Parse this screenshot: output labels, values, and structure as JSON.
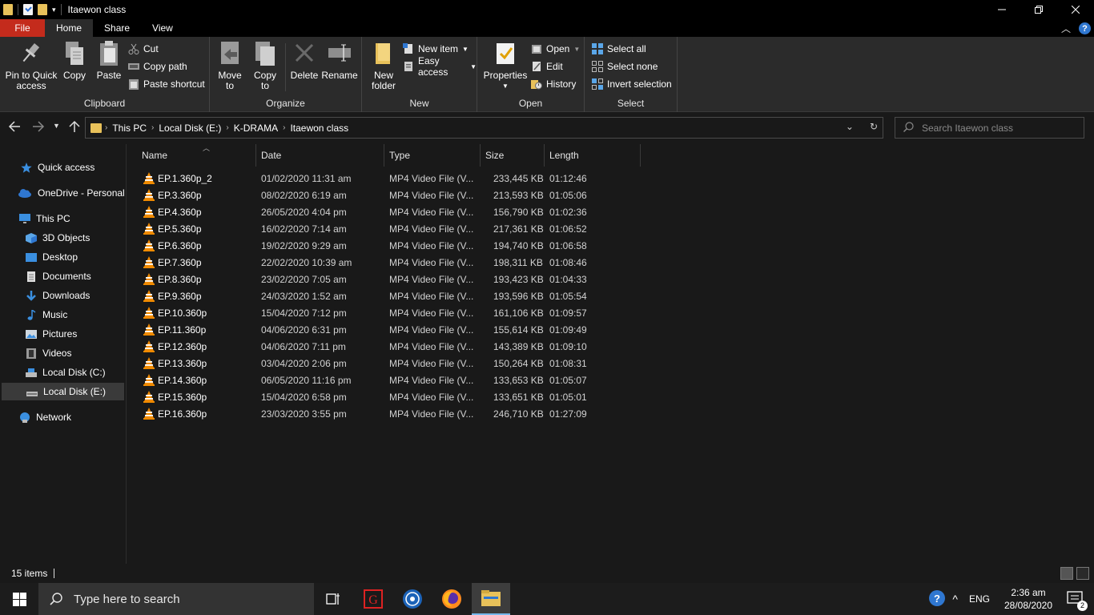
{
  "window": {
    "title": "Itaewon class"
  },
  "ribbon_tabs": [
    "File",
    "Home",
    "Share",
    "View"
  ],
  "ribbon": {
    "clipboard": {
      "label": "Clipboard",
      "pin": "Pin to Quick access",
      "pin_l1": "Pin to Quick",
      "pin_l2": "access",
      "copy": "Copy",
      "paste": "Paste",
      "cut": "Cut",
      "copy_path": "Copy path",
      "paste_shortcut": "Paste shortcut"
    },
    "organize": {
      "label": "Organize",
      "move_l1": "Move",
      "move_l2": "to",
      "copy_l1": "Copy",
      "copy_l2": "to",
      "delete": "Delete",
      "rename": "Rename"
    },
    "new": {
      "label": "New",
      "folder_l1": "New",
      "folder_l2": "folder",
      "new_item": "New item",
      "easy_access": "Easy access"
    },
    "open": {
      "label": "Open",
      "properties": "Properties",
      "open": "Open",
      "edit": "Edit",
      "history": "History"
    },
    "select": {
      "label": "Select",
      "select_all": "Select all",
      "select_none": "Select none",
      "invert": "Invert selection"
    }
  },
  "address": {
    "crumbs": [
      "This PC",
      "Local Disk (E:)",
      "K-DRAMA",
      "Itaewon class"
    ]
  },
  "search": {
    "placeholder": "Search Itaewon class"
  },
  "nav": {
    "quick_access": "Quick access",
    "onedrive": "OneDrive - Personal",
    "this_pc": "This PC",
    "objects3d": "3D Objects",
    "desktop": "Desktop",
    "documents": "Documents",
    "downloads": "Downloads",
    "music": "Music",
    "pictures": "Pictures",
    "videos": "Videos",
    "disk_c": "Local Disk (C:)",
    "disk_e": "Local Disk (E:)",
    "network": "Network"
  },
  "columns": {
    "name": "Name",
    "date": "Date",
    "type": "Type",
    "size": "Size",
    "length": "Length"
  },
  "files": [
    {
      "name": "EP.1.360p_2",
      "date": "01/02/2020 11:31 am",
      "type": "MP4 Video File (V...",
      "size": "233,445 KB",
      "length": "01:12:46"
    },
    {
      "name": "EP.3.360p",
      "date": "08/02/2020 6:19 am",
      "type": "MP4 Video File (V...",
      "size": "213,593 KB",
      "length": "01:05:06"
    },
    {
      "name": "EP.4.360p",
      "date": "26/05/2020 4:04 pm",
      "type": "MP4 Video File (V...",
      "size": "156,790 KB",
      "length": "01:02:36"
    },
    {
      "name": "EP.5.360p",
      "date": "16/02/2020 7:14 am",
      "type": "MP4 Video File (V...",
      "size": "217,361 KB",
      "length": "01:06:52"
    },
    {
      "name": "EP.6.360p",
      "date": "19/02/2020 9:29 am",
      "type": "MP4 Video File (V...",
      "size": "194,740 KB",
      "length": "01:06:58"
    },
    {
      "name": "EP.7.360p",
      "date": "22/02/2020 10:39 am",
      "type": "MP4 Video File (V...",
      "size": "198,311 KB",
      "length": "01:08:46"
    },
    {
      "name": "EP.8.360p",
      "date": "23/02/2020 7:05 am",
      "type": "MP4 Video File (V...",
      "size": "193,423 KB",
      "length": "01:04:33"
    },
    {
      "name": "EP.9.360p",
      "date": "24/03/2020 1:52 am",
      "type": "MP4 Video File (V...",
      "size": "193,596 KB",
      "length": "01:05:54"
    },
    {
      "name": "EP.10.360p",
      "date": "15/04/2020 7:12 pm",
      "type": "MP4 Video File (V...",
      "size": "161,106 KB",
      "length": "01:09:57"
    },
    {
      "name": "EP.11.360p",
      "date": "04/06/2020 6:31 pm",
      "type": "MP4 Video File (V...",
      "size": "155,614 KB",
      "length": "01:09:49"
    },
    {
      "name": "EP.12.360p",
      "date": "04/06/2020 7:11 pm",
      "type": "MP4 Video File (V...",
      "size": "143,389 KB",
      "length": "01:09:10"
    },
    {
      "name": "EP.13.360p",
      "date": "03/04/2020 2:06 pm",
      "type": "MP4 Video File (V...",
      "size": "150,264 KB",
      "length": "01:08:31"
    },
    {
      "name": "EP.14.360p",
      "date": "06/05/2020 11:16 pm",
      "type": "MP4 Video File (V...",
      "size": "133,653 KB",
      "length": "01:05:07"
    },
    {
      "name": "EP.15.360p",
      "date": "15/04/2020 6:58 pm",
      "type": "MP4 Video File (V...",
      "size": "133,651 KB",
      "length": "01:05:01"
    },
    {
      "name": "EP.16.360p",
      "date": "23/03/2020 3:55 pm",
      "type": "MP4 Video File (V...",
      "size": "246,710 KB",
      "length": "01:27:09"
    }
  ],
  "status": {
    "count": "15 items"
  },
  "taskbar": {
    "search_placeholder": "Type here to search",
    "lang": "ENG",
    "time": "2:36 am",
    "date": "28/08/2020",
    "notifications": "2"
  },
  "colors": {
    "file_tab": "#c42b1c",
    "folder": "#e8c15a",
    "accent": "#2f77d1",
    "vlc_orange": "#f08a00"
  },
  "icons": [
    "folder-icon",
    "pin-icon",
    "copy-icon",
    "paste-icon",
    "scissors-icon",
    "delete-icon",
    "rename-icon",
    "properties-icon",
    "select-all-icon",
    "star-icon",
    "cloud-icon",
    "computer-icon",
    "vlc-icon",
    "windows-logo-icon",
    "search-icon"
  ]
}
